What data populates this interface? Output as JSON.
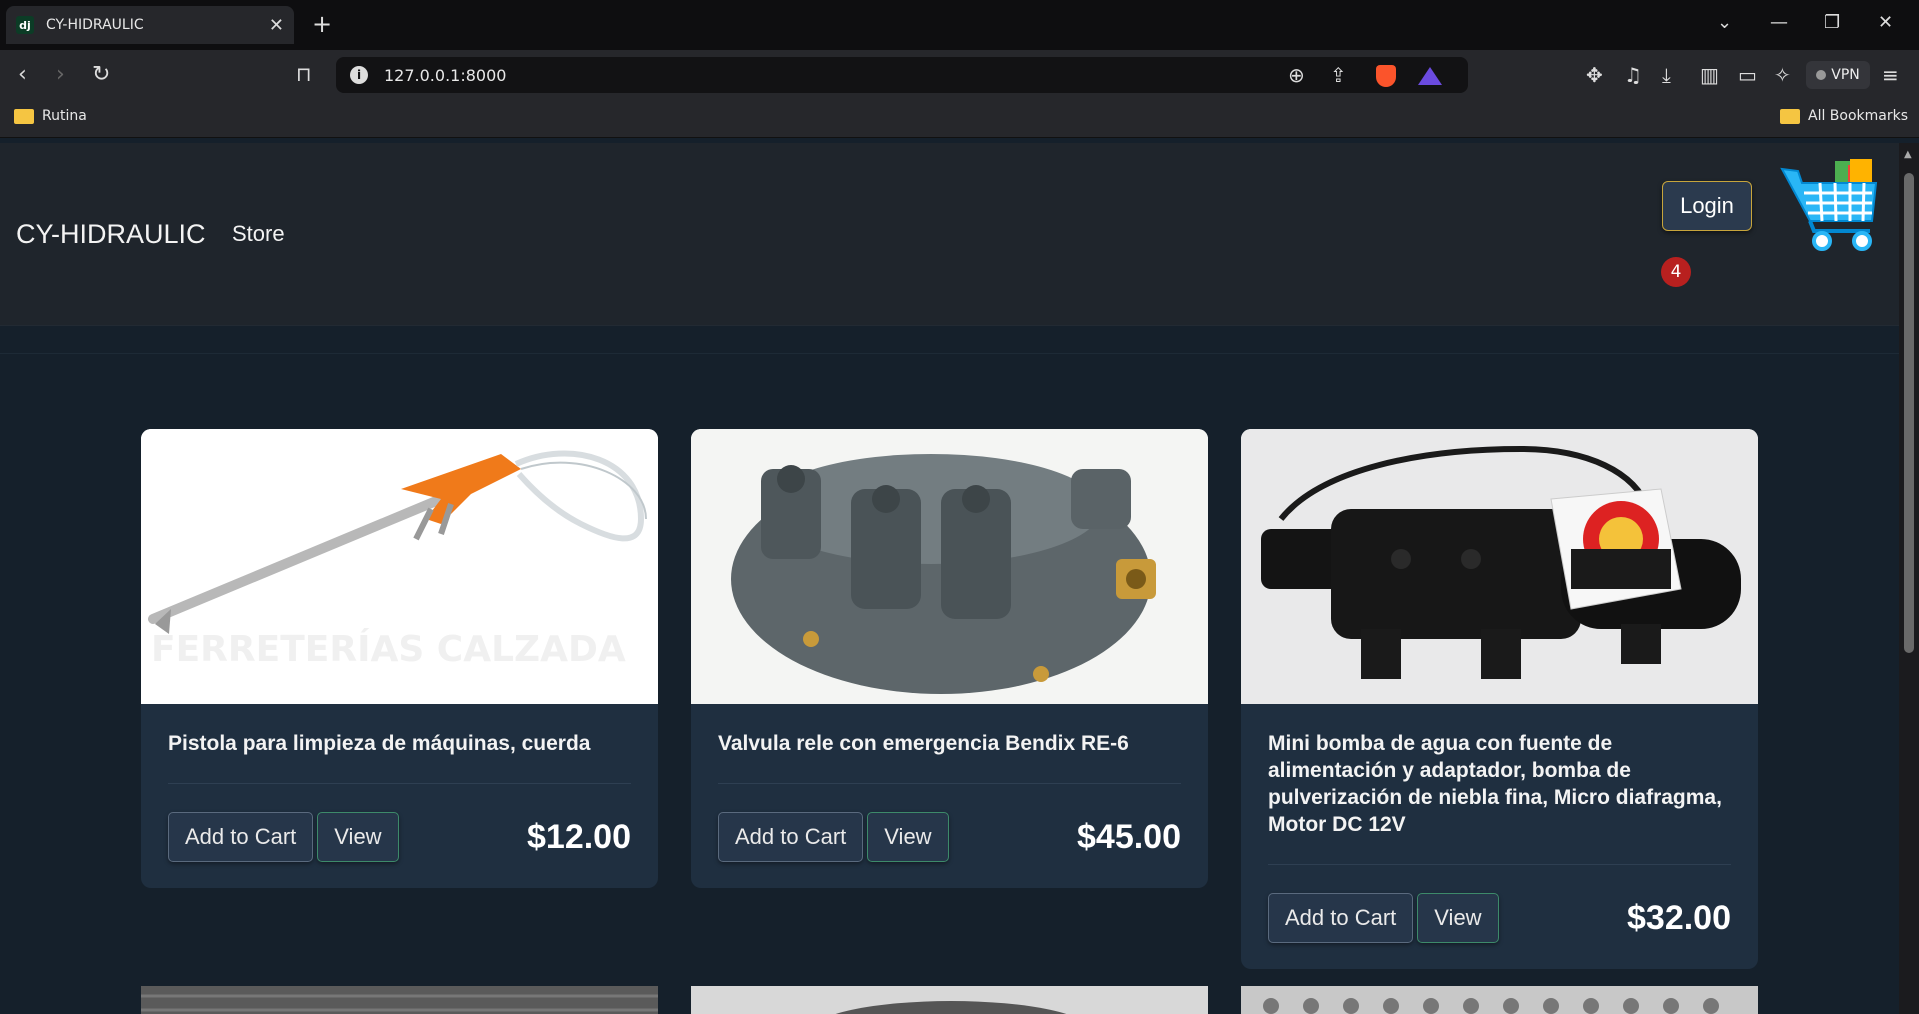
{
  "browser": {
    "tab_title": "CY-HIDRAULIC",
    "favicon_text": "dj",
    "url": "127.0.0.1:8000",
    "vpn_label": "VPN",
    "bookmarks": [
      {
        "label": "Rutina"
      },
      {
        "label": "All Bookmarks"
      }
    ]
  },
  "navbar": {
    "brand": "CY-HIDRAULIC",
    "store_link": "Store",
    "login_label": "Login",
    "cart_count": "4"
  },
  "products": [
    {
      "title": "Pistola para limpieza de máquinas, cuerda",
      "price": "$12.00",
      "add_label": "Add to Cart",
      "view_label": "View",
      "watermark": "FERRETERÍAS CALZADA"
    },
    {
      "title": "Valvula rele con emergencia Bendix RE-6",
      "price": "$45.00",
      "add_label": "Add to Cart",
      "view_label": "View"
    },
    {
      "title": "Mini bomba de agua con fuente de alimentación y adaptador, bomba de pulverización de niebla fina, Micro diafragma, Motor DC 12V",
      "price": "$32.00",
      "add_label": "Add to Cart",
      "view_label": "View"
    }
  ],
  "colors": {
    "page_bg": "#15202b",
    "navbar_bg": "#1f252c",
    "card_bg": "#1f2f40",
    "login_border": "#c7a53c",
    "badge": "#b8201f"
  }
}
